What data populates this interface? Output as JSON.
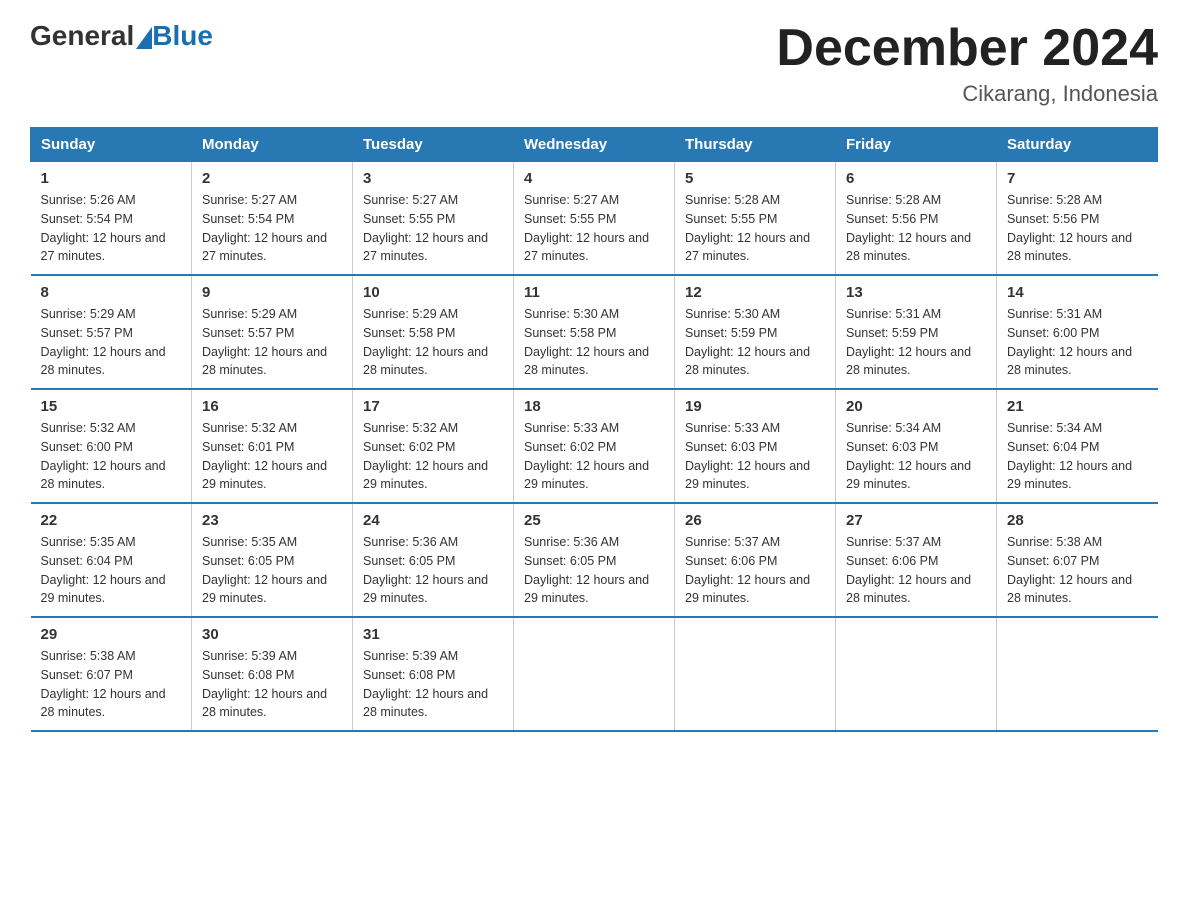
{
  "logo": {
    "text_general": "General",
    "text_blue": "Blue"
  },
  "title": "December 2024",
  "location": "Cikarang, Indonesia",
  "days_of_week": [
    "Sunday",
    "Monday",
    "Tuesday",
    "Wednesday",
    "Thursday",
    "Friday",
    "Saturday"
  ],
  "weeks": [
    [
      {
        "day": "1",
        "sunrise": "5:26 AM",
        "sunset": "5:54 PM",
        "daylight": "12 hours and 27 minutes."
      },
      {
        "day": "2",
        "sunrise": "5:27 AM",
        "sunset": "5:54 PM",
        "daylight": "12 hours and 27 minutes."
      },
      {
        "day": "3",
        "sunrise": "5:27 AM",
        "sunset": "5:55 PM",
        "daylight": "12 hours and 27 minutes."
      },
      {
        "day": "4",
        "sunrise": "5:27 AM",
        "sunset": "5:55 PM",
        "daylight": "12 hours and 27 minutes."
      },
      {
        "day": "5",
        "sunrise": "5:28 AM",
        "sunset": "5:55 PM",
        "daylight": "12 hours and 27 minutes."
      },
      {
        "day": "6",
        "sunrise": "5:28 AM",
        "sunset": "5:56 PM",
        "daylight": "12 hours and 28 minutes."
      },
      {
        "day": "7",
        "sunrise": "5:28 AM",
        "sunset": "5:56 PM",
        "daylight": "12 hours and 28 minutes."
      }
    ],
    [
      {
        "day": "8",
        "sunrise": "5:29 AM",
        "sunset": "5:57 PM",
        "daylight": "12 hours and 28 minutes."
      },
      {
        "day": "9",
        "sunrise": "5:29 AM",
        "sunset": "5:57 PM",
        "daylight": "12 hours and 28 minutes."
      },
      {
        "day": "10",
        "sunrise": "5:29 AM",
        "sunset": "5:58 PM",
        "daylight": "12 hours and 28 minutes."
      },
      {
        "day": "11",
        "sunrise": "5:30 AM",
        "sunset": "5:58 PM",
        "daylight": "12 hours and 28 minutes."
      },
      {
        "day": "12",
        "sunrise": "5:30 AM",
        "sunset": "5:59 PM",
        "daylight": "12 hours and 28 minutes."
      },
      {
        "day": "13",
        "sunrise": "5:31 AM",
        "sunset": "5:59 PM",
        "daylight": "12 hours and 28 minutes."
      },
      {
        "day": "14",
        "sunrise": "5:31 AM",
        "sunset": "6:00 PM",
        "daylight": "12 hours and 28 minutes."
      }
    ],
    [
      {
        "day": "15",
        "sunrise": "5:32 AM",
        "sunset": "6:00 PM",
        "daylight": "12 hours and 28 minutes."
      },
      {
        "day": "16",
        "sunrise": "5:32 AM",
        "sunset": "6:01 PM",
        "daylight": "12 hours and 29 minutes."
      },
      {
        "day": "17",
        "sunrise": "5:32 AM",
        "sunset": "6:02 PM",
        "daylight": "12 hours and 29 minutes."
      },
      {
        "day": "18",
        "sunrise": "5:33 AM",
        "sunset": "6:02 PM",
        "daylight": "12 hours and 29 minutes."
      },
      {
        "day": "19",
        "sunrise": "5:33 AM",
        "sunset": "6:03 PM",
        "daylight": "12 hours and 29 minutes."
      },
      {
        "day": "20",
        "sunrise": "5:34 AM",
        "sunset": "6:03 PM",
        "daylight": "12 hours and 29 minutes."
      },
      {
        "day": "21",
        "sunrise": "5:34 AM",
        "sunset": "6:04 PM",
        "daylight": "12 hours and 29 minutes."
      }
    ],
    [
      {
        "day": "22",
        "sunrise": "5:35 AM",
        "sunset": "6:04 PM",
        "daylight": "12 hours and 29 minutes."
      },
      {
        "day": "23",
        "sunrise": "5:35 AM",
        "sunset": "6:05 PM",
        "daylight": "12 hours and 29 minutes."
      },
      {
        "day": "24",
        "sunrise": "5:36 AM",
        "sunset": "6:05 PM",
        "daylight": "12 hours and 29 minutes."
      },
      {
        "day": "25",
        "sunrise": "5:36 AM",
        "sunset": "6:05 PM",
        "daylight": "12 hours and 29 minutes."
      },
      {
        "day": "26",
        "sunrise": "5:37 AM",
        "sunset": "6:06 PM",
        "daylight": "12 hours and 29 minutes."
      },
      {
        "day": "27",
        "sunrise": "5:37 AM",
        "sunset": "6:06 PM",
        "daylight": "12 hours and 28 minutes."
      },
      {
        "day": "28",
        "sunrise": "5:38 AM",
        "sunset": "6:07 PM",
        "daylight": "12 hours and 28 minutes."
      }
    ],
    [
      {
        "day": "29",
        "sunrise": "5:38 AM",
        "sunset": "6:07 PM",
        "daylight": "12 hours and 28 minutes."
      },
      {
        "day": "30",
        "sunrise": "5:39 AM",
        "sunset": "6:08 PM",
        "daylight": "12 hours and 28 minutes."
      },
      {
        "day": "31",
        "sunrise": "5:39 AM",
        "sunset": "6:08 PM",
        "daylight": "12 hours and 28 minutes."
      },
      null,
      null,
      null,
      null
    ]
  ]
}
